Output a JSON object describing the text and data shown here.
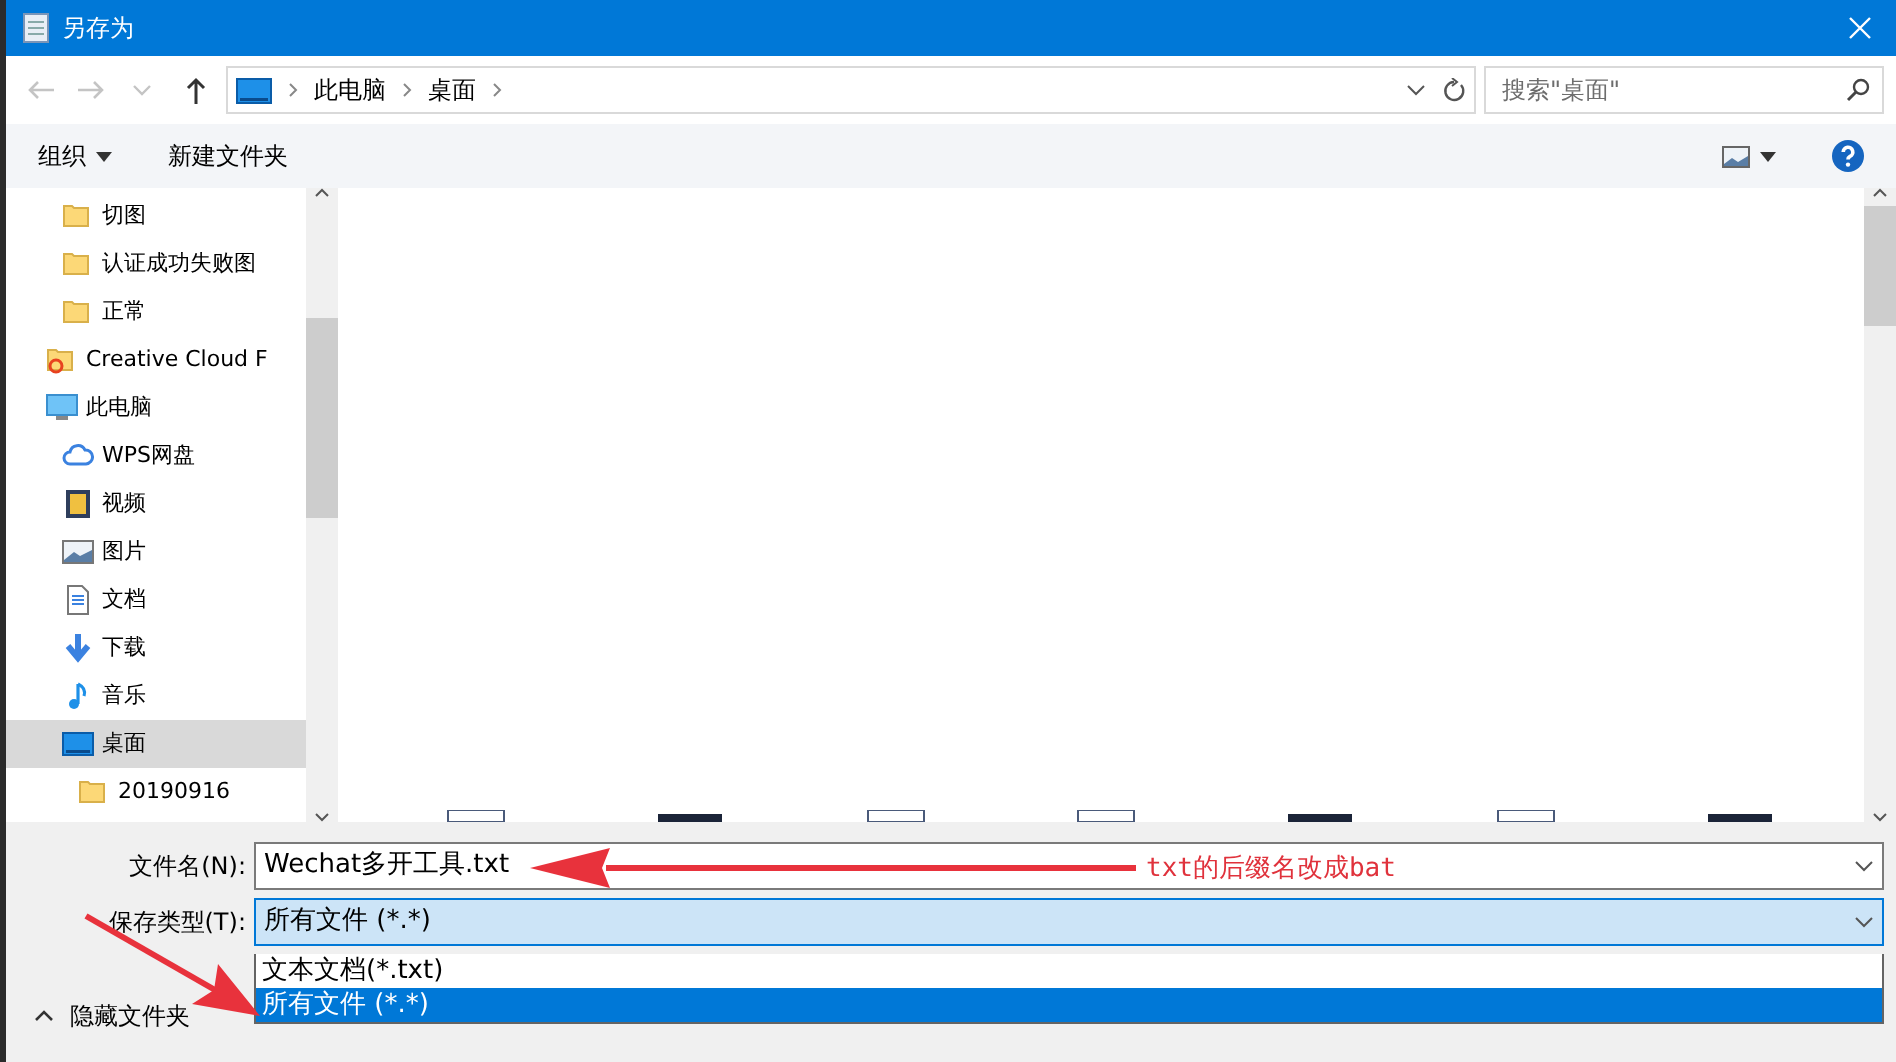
{
  "window": {
    "title": "另存为"
  },
  "nav_buttons": [
    {
      "kind": "back",
      "disabled": true
    },
    {
      "kind": "forward",
      "disabled": true
    },
    {
      "kind": "recent",
      "disabled": true
    },
    {
      "kind": "up",
      "disabled": false
    }
  ],
  "address": {
    "crumbs": [
      "此电脑",
      "桌面"
    ]
  },
  "search": {
    "placeholder": "搜索\"桌面\""
  },
  "toolbar": {
    "organize": "组织",
    "new_folder": "新建文件夹"
  },
  "sidebar": {
    "partial_group": [
      {
        "label": "切图",
        "kind": "folder",
        "selected": false
      },
      {
        "label": "认证成功失败图",
        "kind": "folder",
        "selected": false
      },
      {
        "label": "正常",
        "kind": "folder",
        "selected": false
      }
    ],
    "items": [
      {
        "label": "Creative Cloud F",
        "kind": "cc",
        "selected": false
      },
      {
        "label": "此电脑",
        "kind": "pc",
        "selected": false,
        "children": [
          {
            "label": "WPS网盘",
            "kind": "cloud",
            "selected": false
          },
          {
            "label": "视频",
            "kind": "video",
            "selected": false
          },
          {
            "label": "图片",
            "kind": "picture",
            "selected": false
          },
          {
            "label": "文档",
            "kind": "doc",
            "selected": false
          },
          {
            "label": "下载",
            "kind": "download",
            "selected": false
          },
          {
            "label": "音乐",
            "kind": "music",
            "selected": false
          },
          {
            "label": "桌面",
            "kind": "desktop",
            "selected": true,
            "children": [
              {
                "label": "20190916",
                "kind": "folder",
                "selected": false
              }
            ]
          }
        ]
      }
    ]
  },
  "save_form": {
    "filename_label": "文件名(N):",
    "filename": "Wechat多开工具.txt",
    "type_label": "保存类型(T):",
    "type_value": "所有文件 (*.*)",
    "type_options": [
      {
        "label": "文本文档(*.txt)",
        "selected": false
      },
      {
        "label": "所有文件 (*.*)",
        "selected": true
      }
    ]
  },
  "hide_folders": "隐藏文件夹",
  "annotation": {
    "text": "txt的后缀名改成bat"
  }
}
